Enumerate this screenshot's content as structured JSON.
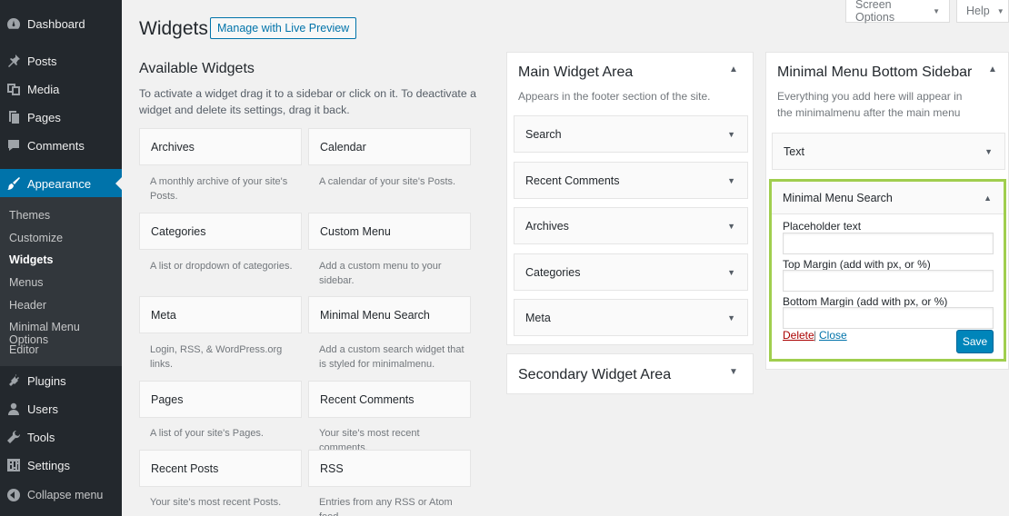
{
  "sidebar": {
    "items": [
      {
        "label": "Dashboard",
        "icon": "dashboard-icon"
      },
      {
        "label": "Posts",
        "icon": "pin-icon"
      },
      {
        "label": "Media",
        "icon": "media-icon"
      },
      {
        "label": "Pages",
        "icon": "pages-icon"
      },
      {
        "label": "Comments",
        "icon": "comment-icon"
      },
      {
        "label": "Appearance",
        "icon": "brush-icon"
      },
      {
        "label": "Plugins",
        "icon": "plug-icon"
      },
      {
        "label": "Users",
        "icon": "user-icon"
      },
      {
        "label": "Tools",
        "icon": "wrench-icon"
      },
      {
        "label": "Settings",
        "icon": "sliders-icon"
      }
    ],
    "submenu": [
      "Themes",
      "Customize",
      "Widgets",
      "Menus",
      "Header",
      "Minimal Menu Options",
      "Editor"
    ],
    "collapse_label": "Collapse menu"
  },
  "top": {
    "screen_options": "Screen Options",
    "help": "Help"
  },
  "header": {
    "title": "Widgets",
    "live_preview": "Manage with Live Preview"
  },
  "available": {
    "title": "Available Widgets",
    "description": "To activate a widget drag it to a sidebar or click on it. To deactivate a widget and delete its settings, drag it back.",
    "widgets": [
      {
        "name": "Archives",
        "desc": "A monthly archive of your site's Posts."
      },
      {
        "name": "Calendar",
        "desc": "A calendar of your site's Posts."
      },
      {
        "name": "Categories",
        "desc": "A list or dropdown of categories."
      },
      {
        "name": "Custom Menu",
        "desc": "Add a custom menu to your sidebar."
      },
      {
        "name": "Meta",
        "desc": "Login, RSS, & WordPress.org links."
      },
      {
        "name": "Minimal Menu Search",
        "desc": "Add a custom search widget that is styled for minimalmenu."
      },
      {
        "name": "Pages",
        "desc": "A list of your site's Pages."
      },
      {
        "name": "Recent Comments",
        "desc": "Your site's most recent comments."
      },
      {
        "name": "Recent Posts",
        "desc": "Your site's most recent Posts."
      },
      {
        "name": "RSS",
        "desc": "Entries from any RSS or Atom feed."
      }
    ]
  },
  "main_area": {
    "title": "Main Widget Area",
    "description": "Appears in the footer section of the site.",
    "widgets": [
      "Search",
      "Recent Comments",
      "Archives",
      "Categories",
      "Meta"
    ]
  },
  "secondary_area": {
    "title": "Secondary Widget Area"
  },
  "bottom_sidebar": {
    "title": "Minimal Menu Bottom Sidebar",
    "description": "Everything you add here will appear in the minimalmenu after the main menu",
    "text_widget": "Text",
    "search_widget": {
      "title": "Minimal Menu Search",
      "fields": [
        "Placeholder text",
        "Top Margin (add with px, or %)",
        "Bottom Margin (add with px, or %)"
      ],
      "delete": "Delete",
      "separator": "|",
      "close": "Close",
      "save": "Save"
    }
  },
  "colors": {
    "accent": "#0073aa",
    "highlight_border": "#a0ce4e",
    "sidebar_bg": "#23282d"
  }
}
